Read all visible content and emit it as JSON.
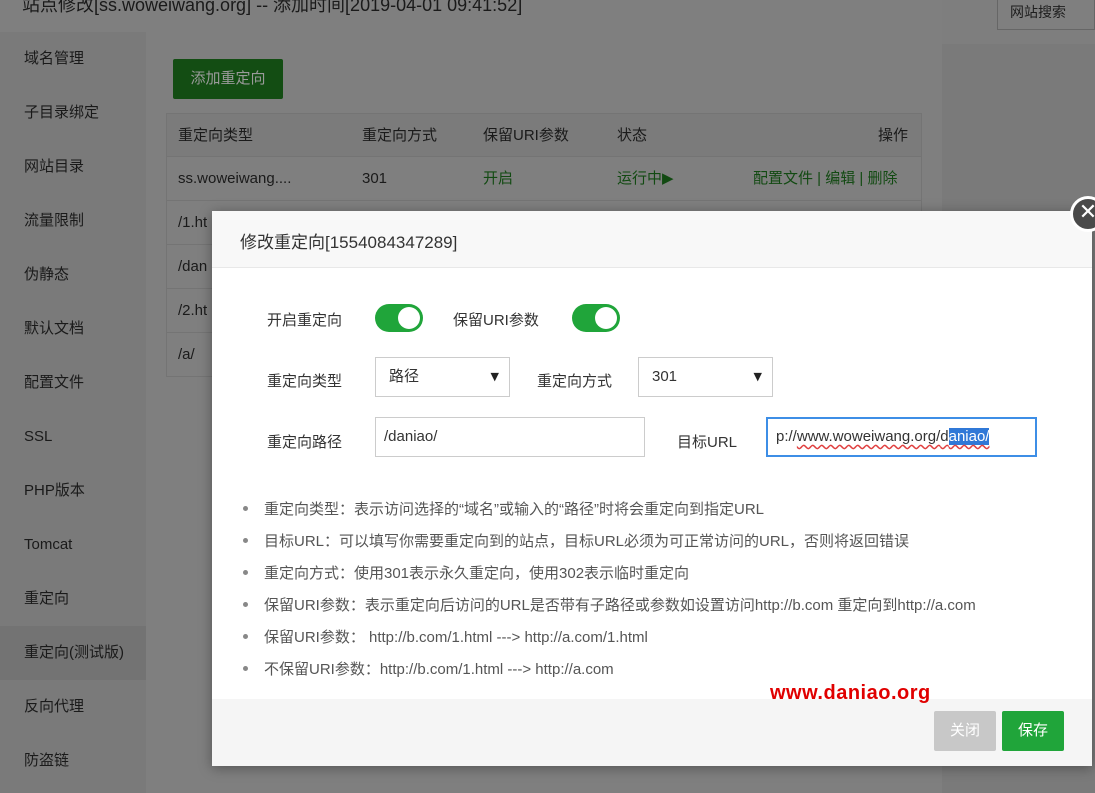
{
  "background": {
    "header_title": "站点修改[ss.woweiwang.org] -- 添加时间[2019-04-01 09:41:52]",
    "search_button": "网站搜索",
    "sidebar": [
      {
        "label": "域名管理"
      },
      {
        "label": "子目录绑定"
      },
      {
        "label": "网站目录"
      },
      {
        "label": "流量限制"
      },
      {
        "label": "伪静态"
      },
      {
        "label": "默认文档"
      },
      {
        "label": "配置文件"
      },
      {
        "label": "SSL"
      },
      {
        "label": "PHP版本"
      },
      {
        "label": "Tomcat"
      },
      {
        "label": "重定向"
      },
      {
        "label": "重定向(测试版)"
      },
      {
        "label": "反向代理"
      },
      {
        "label": "防盗链"
      }
    ],
    "add_button": "添加重定向",
    "table": {
      "headers": [
        "重定向类型",
        "重定向方式",
        "保留URI参数",
        "状态",
        "操作"
      ],
      "rows": [
        {
          "type": "ss.woweiwang....",
          "method": "301",
          "keep_uri": "开启",
          "status": "运行中▶",
          "actions": "配置文件 | 编辑 | 删除"
        },
        {
          "type": "/1.ht",
          "method": "",
          "keep_uri": "",
          "status": "",
          "actions": ""
        },
        {
          "type": "/dan",
          "method": "",
          "keep_uri": "",
          "status": "",
          "actions": ""
        },
        {
          "type": "/2.ht",
          "method": "",
          "keep_uri": "",
          "status": "",
          "actions": ""
        },
        {
          "type": "/a/",
          "method": "",
          "keep_uri": "",
          "status": "",
          "actions": ""
        }
      ]
    }
  },
  "modal": {
    "title": "修改重定向[1554084347289]",
    "close_icon": "close-icon",
    "enable_redirect_label": "开启重定向",
    "enable_redirect_on": true,
    "keep_uri_label": "保留URI参数",
    "keep_uri_on": true,
    "redirect_type_label": "重定向类型",
    "redirect_type_value": "路径",
    "redirect_method_label": "重定向方式",
    "redirect_method_value": "301",
    "redirect_path_label": "重定向路径",
    "redirect_path_value": "/daniao/",
    "target_url_label": "目标URL",
    "target_url_prefix": "p://",
    "target_url_underlined": "www.woweiwang.org/",
    "target_url_d": "d",
    "target_url_selected": "aniao/",
    "tips": [
      "重定向类型：表示访问选择的“域名”或输入的“路径”时将会重定向到指定URL",
      "目标URL：可以填写你需要重定向到的站点，目标URL必须为可正常访问的URL，否则将返回错误",
      "重定向方式：使用301表示永久重定向，使用302表示临时重定向",
      "保留URI参数：表示重定向后访问的URL是否带有子路径或参数如设置访问http://b.com 重定向到http://a.com",
      "保留URI参数：  http://b.com/1.html ---> http://a.com/1.html",
      "不保留URI参数：http://b.com/1.html ---> http://a.com"
    ],
    "close_button": "关闭",
    "save_button": "保存"
  },
  "watermark": "www.daniao.org",
  "colors": {
    "accent": "#20a53a",
    "focus": "#3d8ee6",
    "watermark": "#e00000"
  }
}
